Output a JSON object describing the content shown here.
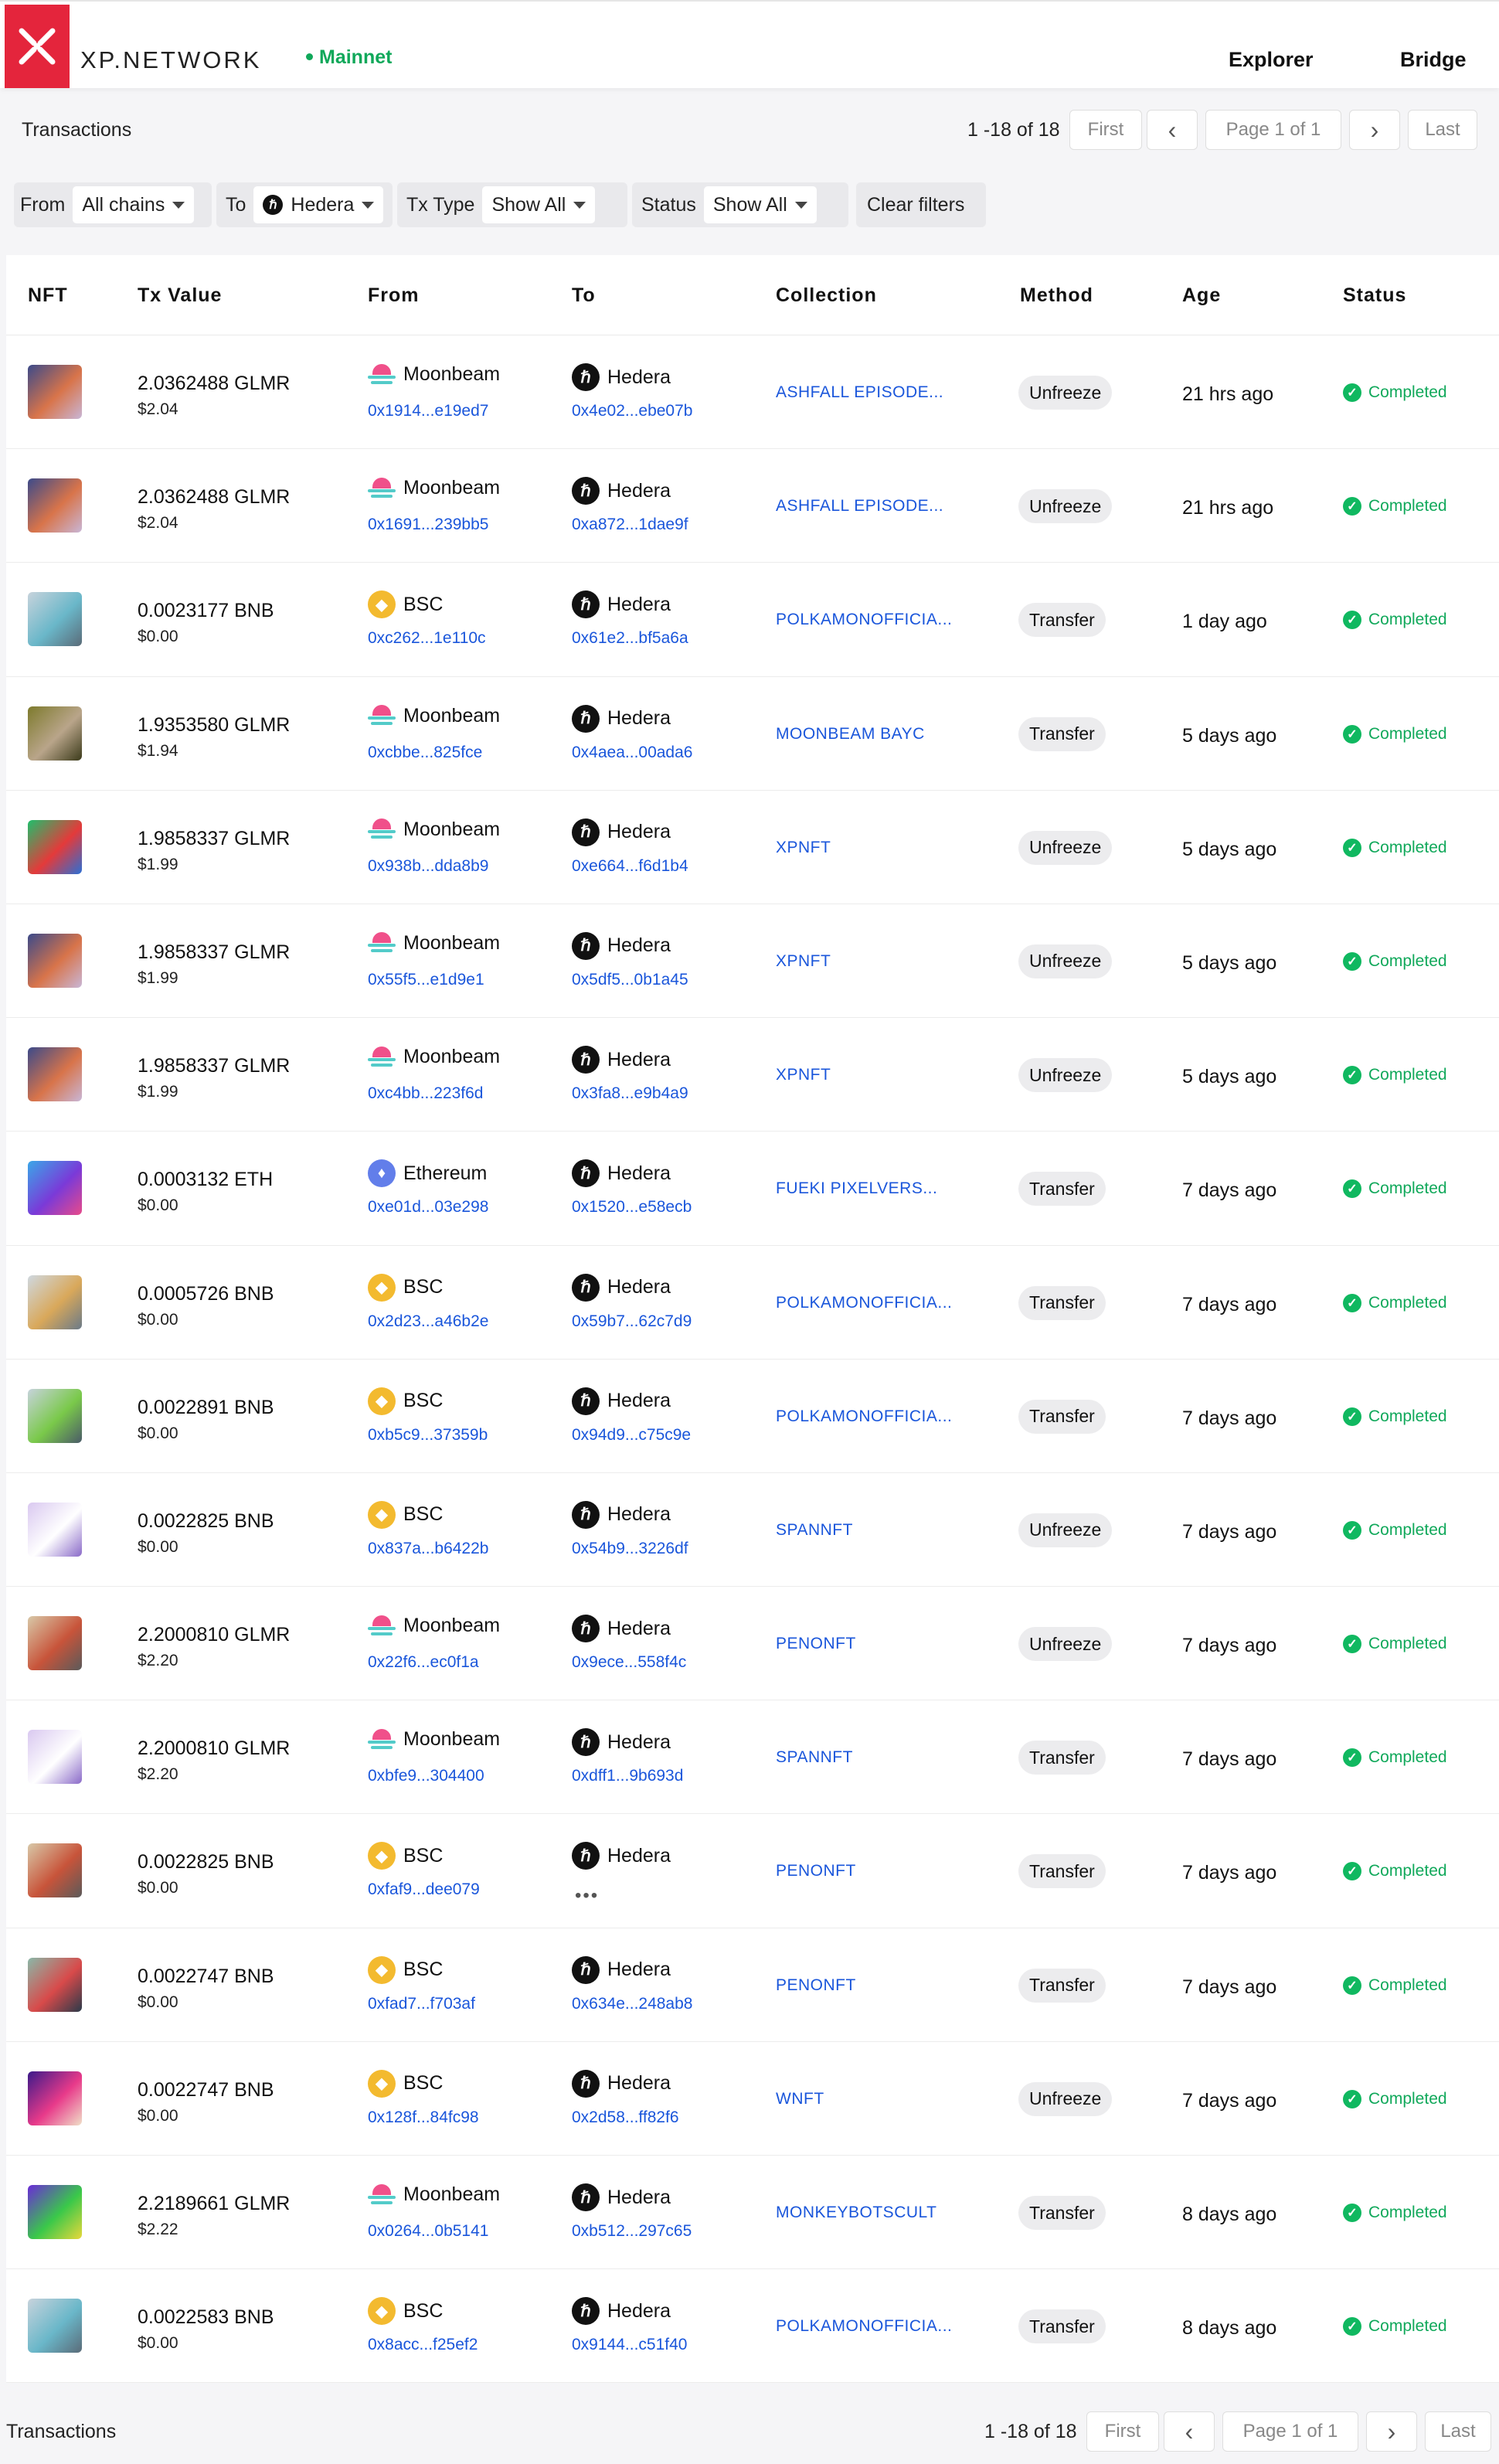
{
  "header": {
    "brand": "XP.NETWORK",
    "network": "Mainnet",
    "nav": [
      "Explorer",
      "Bridge"
    ]
  },
  "pager_top": {
    "title": "Transactions",
    "count": "1 -18 of 18",
    "first": "First",
    "prev": "‹",
    "page": "Page 1 of 1",
    "next": "›",
    "last": "Last"
  },
  "pager_bottom": {
    "title": "Transactions",
    "count": "1 -18 of 18",
    "first": "First",
    "prev": "‹",
    "page": "Page 1 of 1",
    "next": "›",
    "last": "Last"
  },
  "filters": {
    "from_label": "From",
    "from_value": "All chains",
    "to_label": "To",
    "to_value": "Hedera",
    "txtype_label": "Tx Type",
    "txtype_value": "Show All",
    "status_label": "Status",
    "status_value": "Show All",
    "clear": "Clear filters"
  },
  "columns": [
    "NFT",
    "Tx Value",
    "From",
    "To",
    "Collection",
    "Method",
    "Age",
    "Status"
  ],
  "colors": {
    "accent": "#e4253c",
    "link": "#1a56db",
    "success": "#10a85a"
  },
  "rows": [
    {
      "thumb": [
        "#3b4a8a",
        "#d8744a",
        "#c9b6d6"
      ],
      "value": "2.0362488 GLMR",
      "usd": "$2.04",
      "from_chain": "Moonbeam",
      "from_icon": "moonbeam-icon",
      "from_addr": "0x1914...e19ed7",
      "to_chain": "Hedera",
      "to_addr": "0x4e02...ebe07b",
      "collection": "ASHFALL EPISODE...",
      "method": "Unfreeze",
      "age": "21 hrs ago",
      "status": "Completed"
    },
    {
      "thumb": [
        "#3b4a8a",
        "#d8744a",
        "#c9b6d6"
      ],
      "value": "2.0362488 GLMR",
      "usd": "$2.04",
      "from_chain": "Moonbeam",
      "from_icon": "moonbeam-icon",
      "from_addr": "0x1691...239bb5",
      "to_chain": "Hedera",
      "to_addr": "0xa872...1dae9f",
      "collection": "ASHFALL EPISODE...",
      "method": "Unfreeze",
      "age": "21 hrs ago",
      "status": "Completed"
    },
    {
      "thumb": [
        "#c7d3dc",
        "#6ab7c9",
        "#5a6b78"
      ],
      "value": "0.0023177 BNB",
      "usd": "$0.00",
      "from_chain": "BSC",
      "from_icon": "bsc-icon",
      "from_addr": "0xc262...1e110c",
      "to_chain": "Hedera",
      "to_addr": "0x61e2...bf5a6a",
      "collection": "POLKAMONOFFICIA...",
      "method": "Transfer",
      "age": "1 day ago",
      "status": "Completed"
    },
    {
      "thumb": [
        "#7d7a2c",
        "#b9a58a",
        "#3b3a1a"
      ],
      "value": "1.9353580 GLMR",
      "usd": "$1.94",
      "from_chain": "Moonbeam",
      "from_icon": "moonbeam-icon",
      "from_addr": "0xcbbe...825fce",
      "to_chain": "Hedera",
      "to_addr": "0x4aea...00ada6",
      "collection": "MOONBEAM BAYC",
      "method": "Transfer",
      "age": "5 days ago",
      "status": "Completed"
    },
    {
      "thumb": [
        "#1fbf6b",
        "#e43a3a",
        "#2a6fd6"
      ],
      "value": "1.9858337 GLMR",
      "usd": "$1.99",
      "from_chain": "Moonbeam",
      "from_icon": "moonbeam-icon",
      "from_addr": "0x938b...dda8b9",
      "to_chain": "Hedera",
      "to_addr": "0xe664...f6d1b4",
      "collection": "XPNFT",
      "method": "Unfreeze",
      "age": "5 days ago",
      "status": "Completed"
    },
    {
      "thumb": [
        "#3b4a8a",
        "#d8744a",
        "#c9b6d6"
      ],
      "value": "1.9858337 GLMR",
      "usd": "$1.99",
      "from_chain": "Moonbeam",
      "from_icon": "moonbeam-icon",
      "from_addr": "0x55f5...e1d9e1",
      "to_chain": "Hedera",
      "to_addr": "0x5df5...0b1a45",
      "collection": "XPNFT",
      "method": "Unfreeze",
      "age": "5 days ago",
      "status": "Completed"
    },
    {
      "thumb": [
        "#3b4a8a",
        "#d8744a",
        "#c9b6d6"
      ],
      "value": "1.9858337 GLMR",
      "usd": "$1.99",
      "from_chain": "Moonbeam",
      "from_icon": "moonbeam-icon",
      "from_addr": "0xc4bb...223f6d",
      "to_chain": "Hedera",
      "to_addr": "0x3fa8...e9b4a9",
      "collection": "XPNFT",
      "method": "Unfreeze",
      "age": "5 days ago",
      "status": "Completed"
    },
    {
      "thumb": [
        "#3aa7e8",
        "#7a3ad8",
        "#e84a8a"
      ],
      "value": "0.0003132 ETH",
      "usd": "$0.00",
      "from_chain": "Ethereum",
      "from_icon": "ethereum-icon",
      "from_addr": "0xe01d...03e298",
      "to_chain": "Hedera",
      "to_addr": "0x1520...e58ecb",
      "collection": "FUEKI PIXELVERS...",
      "method": "Transfer",
      "age": "7 days ago",
      "status": "Completed"
    },
    {
      "thumb": [
        "#cfd8e0",
        "#d9a85a",
        "#6a7a88"
      ],
      "value": "0.0005726 BNB",
      "usd": "$0.00",
      "from_chain": "BSC",
      "from_icon": "bsc-icon",
      "from_addr": "0x2d23...a46b2e",
      "to_chain": "Hedera",
      "to_addr": "0x59b7...62c7d9",
      "collection": "POLKAMONOFFICIA...",
      "method": "Transfer",
      "age": "7 days ago",
      "status": "Completed"
    },
    {
      "thumb": [
        "#c7d3dc",
        "#7ac94a",
        "#4a5a68"
      ],
      "value": "0.0022891 BNB",
      "usd": "$0.00",
      "from_chain": "BSC",
      "from_icon": "bsc-icon",
      "from_addr": "0xb5c9...37359b",
      "to_chain": "Hedera",
      "to_addr": "0x94d9...c75c9e",
      "collection": "POLKAMONOFFICIA...",
      "method": "Transfer",
      "age": "7 days ago",
      "status": "Completed"
    },
    {
      "thumb": [
        "#d9c8f0",
        "#ffffff",
        "#8a6ac8"
      ],
      "value": "0.0022825 BNB",
      "usd": "$0.00",
      "from_chain": "BSC",
      "from_icon": "bsc-icon",
      "from_addr": "0x837a...b6422b",
      "to_chain": "Hedera",
      "to_addr": "0x54b9...3226df",
      "collection": "SPANNFT",
      "method": "Unfreeze",
      "age": "7 days ago",
      "status": "Completed"
    },
    {
      "thumb": [
        "#d8c8a8",
        "#c8543a",
        "#5a5a5a"
      ],
      "value": "2.2000810 GLMR",
      "usd": "$2.20",
      "from_chain": "Moonbeam",
      "from_icon": "moonbeam-icon",
      "from_addr": "0x22f6...ec0f1a",
      "to_chain": "Hedera",
      "to_addr": "0x9ece...558f4c",
      "collection": "PENONFT",
      "method": "Unfreeze",
      "age": "7 days ago",
      "status": "Completed"
    },
    {
      "thumb": [
        "#d9c8f0",
        "#ffffff",
        "#8a6ac8"
      ],
      "value": "2.2000810 GLMR",
      "usd": "$2.20",
      "from_chain": "Moonbeam",
      "from_icon": "moonbeam-icon",
      "from_addr": "0xbfe9...304400",
      "to_chain": "Hedera",
      "to_addr": "0xdff1...9b693d",
      "collection": "SPANNFT",
      "method": "Transfer",
      "age": "7 days ago",
      "status": "Completed"
    },
    {
      "thumb": [
        "#d8c8a8",
        "#c8543a",
        "#5a5a5a"
      ],
      "value": "0.0022825 BNB",
      "usd": "$0.00",
      "from_chain": "BSC",
      "from_icon": "bsc-icon",
      "from_addr": "0xfaf9...dee079",
      "to_chain": "Hedera",
      "to_addr": "",
      "collection": "PENONFT",
      "method": "Transfer",
      "age": "7 days ago",
      "status": "Completed"
    },
    {
      "thumb": [
        "#8ab8a8",
        "#d84a4a",
        "#2a3a4a"
      ],
      "value": "0.0022747 BNB",
      "usd": "$0.00",
      "from_chain": "BSC",
      "from_icon": "bsc-icon",
      "from_addr": "0xfad7...f703af",
      "to_chain": "Hedera",
      "to_addr": "0x634e...248ab8",
      "collection": "PENONFT",
      "method": "Transfer",
      "age": "7 days ago",
      "status": "Completed"
    },
    {
      "thumb": [
        "#3a1a8a",
        "#e83a8a",
        "#f0e0c8"
      ],
      "value": "0.0022747 BNB",
      "usd": "$0.00",
      "from_chain": "BSC",
      "from_icon": "bsc-icon",
      "from_addr": "0x128f...84fc98",
      "to_chain": "Hedera",
      "to_addr": "0x2d58...ff82f6",
      "collection": "WNFT",
      "method": "Unfreeze",
      "age": "7 days ago",
      "status": "Completed"
    },
    {
      "thumb": [
        "#6a2ad8",
        "#3ac84a",
        "#e8d83a"
      ],
      "value": "2.2189661 GLMR",
      "usd": "$2.22",
      "from_chain": "Moonbeam",
      "from_icon": "moonbeam-icon",
      "from_addr": "0x0264...0b5141",
      "to_chain": "Hedera",
      "to_addr": "0xb512...297c65",
      "collection": "MONKEYBOTSCULT",
      "method": "Transfer",
      "age": "8 days ago",
      "status": "Completed"
    },
    {
      "thumb": [
        "#c7d3dc",
        "#6ab7c9",
        "#5a6b78"
      ],
      "value": "0.0022583 BNB",
      "usd": "$0.00",
      "from_chain": "BSC",
      "from_icon": "bsc-icon",
      "from_addr": "0x8acc...f25ef2",
      "to_chain": "Hedera",
      "to_addr": "0x9144...c51f40",
      "collection": "POLKAMONOFFICIA...",
      "method": "Transfer",
      "age": "8 days ago",
      "status": "Completed"
    }
  ]
}
